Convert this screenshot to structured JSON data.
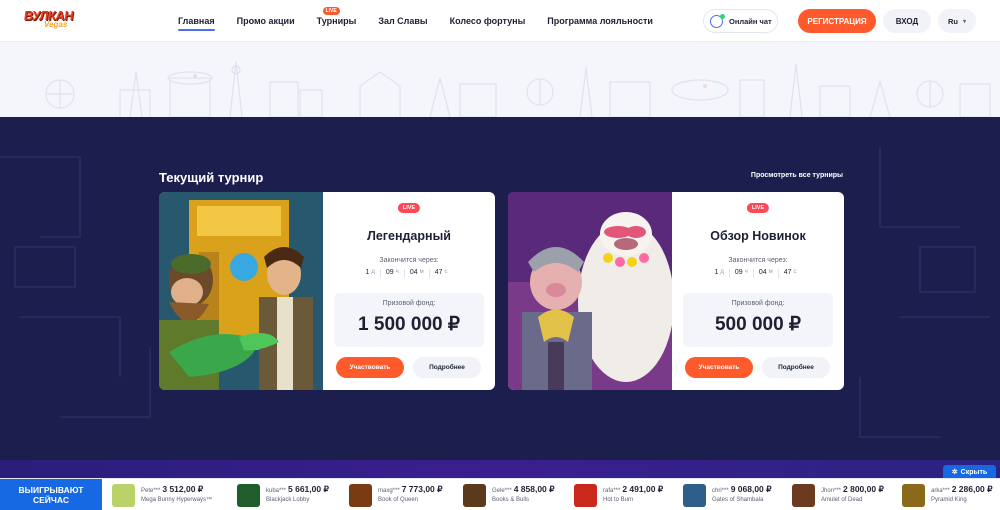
{
  "logo": {
    "brand": "ВУЛКАН",
    "sub": "Vegas"
  },
  "nav": [
    {
      "label": "Главная",
      "active": true
    },
    {
      "label": "Промо акции"
    },
    {
      "label": "Турниры",
      "badge": "LIVE"
    },
    {
      "label": "Зал Славы"
    },
    {
      "label": "Колесо фортуны"
    },
    {
      "label": "Программа лояльности"
    }
  ],
  "header": {
    "chat_label": "Онлайн чат",
    "register_label": "РЕГИСТРАЦИЯ",
    "login_label": "ВХОД",
    "lang": "Ru"
  },
  "section": {
    "title": "Текущий турнир",
    "see_all": "Просмотреть все турниры"
  },
  "tournaments": [
    {
      "badge": "LIVE",
      "name": "Легендарный",
      "ends_label": "Закончится через:",
      "timer": {
        "d": "1",
        "d_u": "д",
        "h": "09",
        "h_u": "ч",
        "m": "04",
        "m_u": "м",
        "s": "47",
        "s_u": "с"
      },
      "prize_label": "Призовой фонд:",
      "prize_value": "1 500 000 ₽",
      "join_label": "Участвовать",
      "more_label": "Подробнее"
    },
    {
      "badge": "LIVE",
      "name": "Обзор Новинок",
      "ends_label": "Закончится через:",
      "timer": {
        "d": "1",
        "d_u": "д",
        "h": "09",
        "h_u": "ч",
        "m": "04",
        "m_u": "м",
        "s": "47",
        "s_u": "с"
      },
      "prize_label": "Призовой фонд:",
      "prize_value": "500 000 ₽",
      "join_label": "Участвовать",
      "more_label": "Подробнее"
    }
  ],
  "ticker": {
    "title_line1": "ВЫИГРЫВАЮТ",
    "title_line2": "СЕЙЧАС",
    "hide_label": "Скрыть",
    "items": [
      {
        "user": "Pete***",
        "amount": "3 512,00 ₽",
        "game": "Mega Bunny Hyperways™",
        "color": "#b9d36a"
      },
      {
        "user": "kuba***",
        "amount": "5 661,00 ₽",
        "game": "Blackjack Lobby",
        "color": "#1f5e2a"
      },
      {
        "user": "maxg***",
        "amount": "7 773,00 ₽",
        "game": "Book of Queen",
        "color": "#7a3b12"
      },
      {
        "user": "Gele***",
        "amount": "4 858,00 ₽",
        "game": "Books & Bulls",
        "color": "#5a3a1a"
      },
      {
        "user": "rafa***",
        "amount": "2 491,00 ₽",
        "game": "Hot to Burn",
        "color": "#c9281d"
      },
      {
        "user": "chri***",
        "amount": "9 068,00 ₽",
        "game": "Gates of Shambala",
        "color": "#2e5f8a"
      },
      {
        "user": "Jhon***",
        "amount": "2 800,00 ₽",
        "game": "Amulet of Dead",
        "color": "#6b3a1f"
      },
      {
        "user": "arka***",
        "amount": "2 286,00 ₽",
        "game": "Pyramid King",
        "color": "#8a6a1a"
      }
    ]
  }
}
